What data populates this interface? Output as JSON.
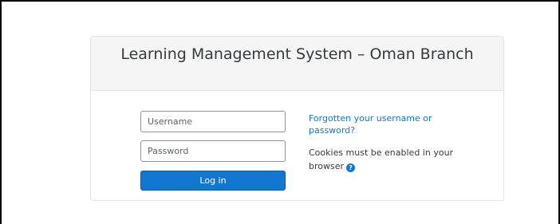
{
  "login": {
    "title": "Learning Management System – Oman Branch",
    "username": {
      "value": "",
      "placeholder": "Username"
    },
    "password": {
      "value": "",
      "placeholder": "Password"
    },
    "login_button_label": "Log in",
    "forgot_link_text": "Forgotten your username or password?",
    "cookies_notice": "Cookies must be enabled in your browser",
    "help_icon": "question-circle-icon",
    "help_icon_glyph": "?"
  },
  "colors": {
    "accent": "#1177d1",
    "header_background": "#f5f5f5",
    "text": "#373a3c"
  }
}
